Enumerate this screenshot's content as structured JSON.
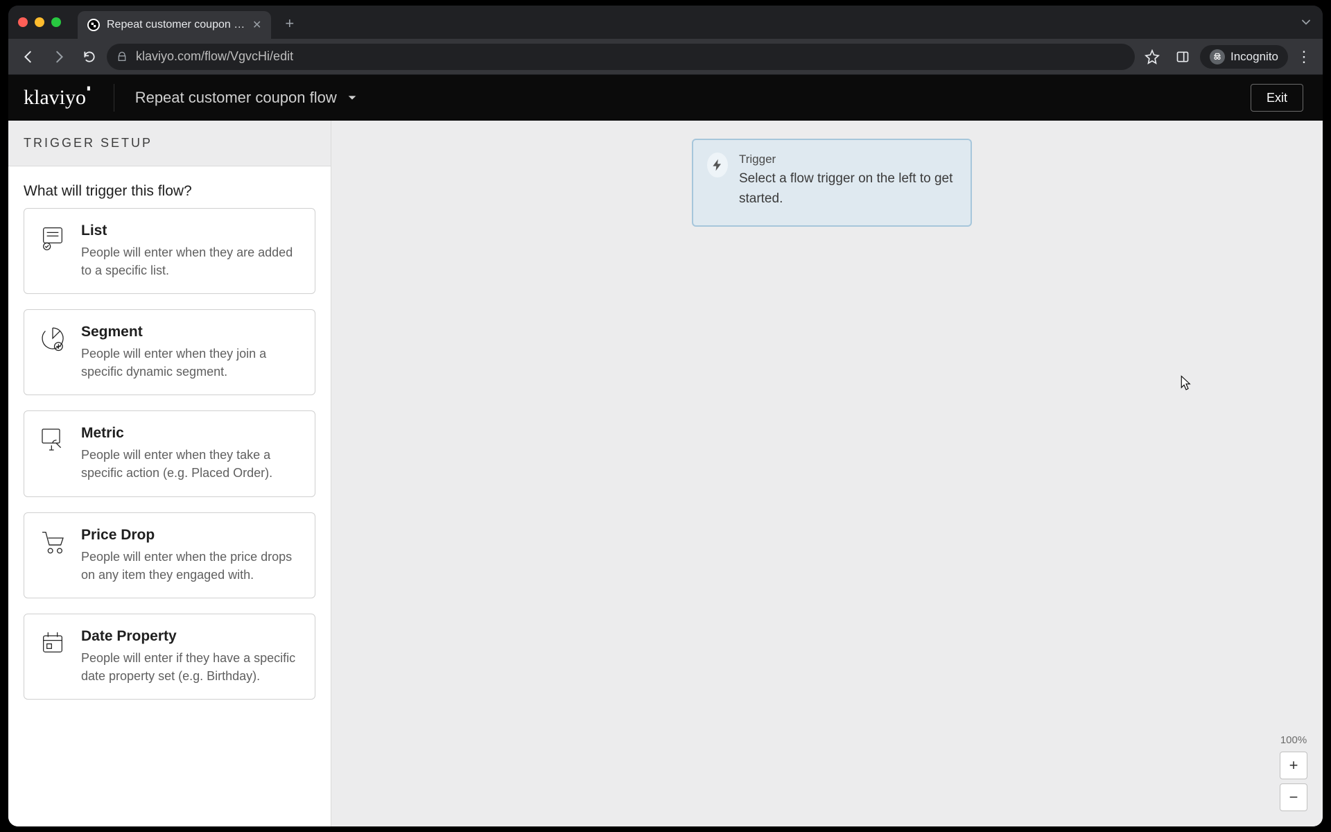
{
  "browser": {
    "tab_title": "Repeat customer coupon flow",
    "url_display": "klaviyo.com/flow/VgvcHi/edit",
    "url_host": "klaviyo.com",
    "url_path": "/flow/VgvcHi/edit",
    "incognito_label": "Incognito"
  },
  "header": {
    "logo_text": "klaviyo",
    "flow_name": "Repeat customer coupon flow",
    "exit_label": "Exit"
  },
  "sidebar": {
    "section_title": "TRIGGER SETUP",
    "question": "What will trigger this flow?",
    "triggers": [
      {
        "title": "List",
        "desc": "People will enter when they are added to a specific list."
      },
      {
        "title": "Segment",
        "desc": "People will enter when they join a specific dynamic segment."
      },
      {
        "title": "Metric",
        "desc": "People will enter when they take a specific action (e.g. Placed Order)."
      },
      {
        "title": "Price Drop",
        "desc": "People will enter when the price drops on any item they engaged with."
      },
      {
        "title": "Date Property",
        "desc": "People will enter if they have a specific date property set (e.g. Birthday)."
      }
    ]
  },
  "canvas": {
    "node_title": "Trigger",
    "node_desc": "Select a flow trigger on the left to get started."
  },
  "zoom": {
    "percent_label": "100%",
    "plus": "+",
    "minus": "−"
  }
}
